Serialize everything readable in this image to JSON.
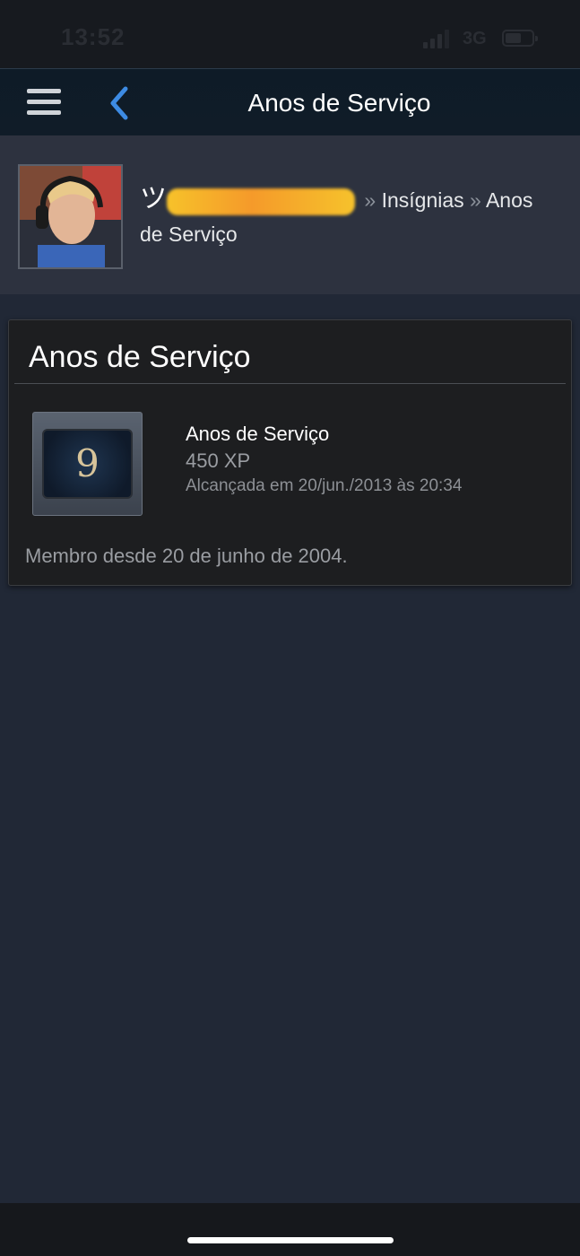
{
  "status_bar": {
    "time": "13:52",
    "network": "3G",
    "battery_level": 0.6
  },
  "nav": {
    "title": "Anos de Serviço"
  },
  "profile": {
    "user_initial": "ツ",
    "separator": "»",
    "crumb_badges": "Insígnias",
    "crumb_current": "Anos de Serviço"
  },
  "badge": {
    "card_title": "Anos de Serviço",
    "level": "9",
    "name": "Anos de Serviço",
    "xp": "450 XP",
    "unlocked": "Alcançada em 20/jun./2013 às 20:34",
    "member_since": "Membro desde 20 de junho de 2004."
  },
  "colors": {
    "accent_blue": "#3d8be3",
    "page_bg": "#212836"
  }
}
